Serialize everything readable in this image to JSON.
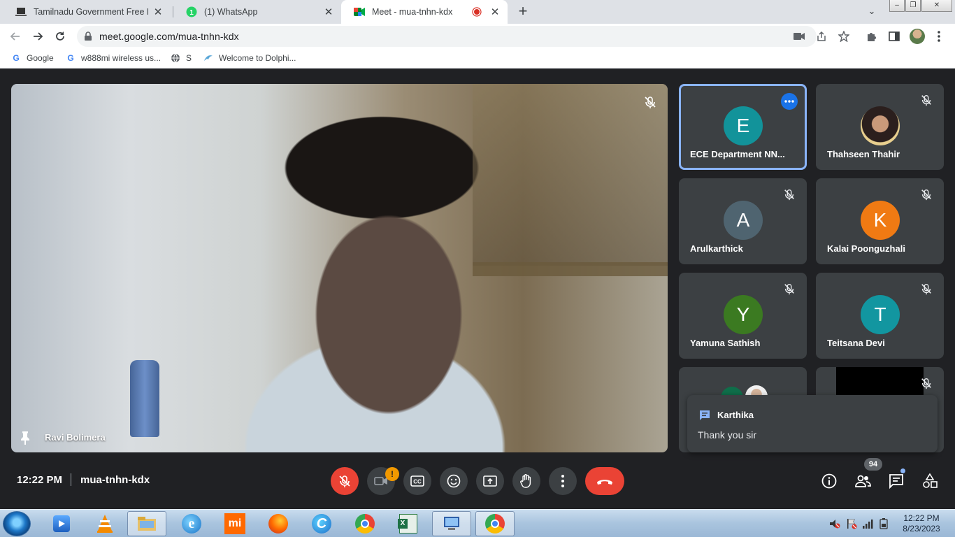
{
  "browser": {
    "tabs": [
      {
        "title": "Tamilnadu Government Free Lapt",
        "icon": "laptop-favicon"
      },
      {
        "title": "(1) WhatsApp",
        "icon": "whatsapp-favicon"
      },
      {
        "title": "Meet - mua-tnhn-kdx",
        "icon": "meet-favicon",
        "active": true,
        "recording": true
      }
    ],
    "url": "meet.google.com/mua-tnhn-kdx",
    "bookmarks": [
      {
        "label": "Google",
        "icon": "google-icon"
      },
      {
        "label": "w888mi wireless us...",
        "icon": "google-icon"
      },
      {
        "label": "S",
        "icon": "globe-icon"
      },
      {
        "label": "Welcome to Dolphi...",
        "icon": "dolphin-icon"
      }
    ]
  },
  "meeting": {
    "main_speaker": "Ravi Bolimera",
    "participants": [
      {
        "initial": "E",
        "name": "ECE Department NN...",
        "color": "#12939a",
        "highlighted": true
      },
      {
        "initial": "",
        "name": "Thahseen Thahir",
        "photo": true
      },
      {
        "initial": "A",
        "name": "Arulkarthick",
        "color": "#4f6470"
      },
      {
        "initial": "K",
        "name": "Kalai Poonguzhali",
        "color": "#f07a13"
      },
      {
        "initial": "Y",
        "name": "Yamuna Sathish",
        "color": "#3b7a21"
      },
      {
        "initial": "T",
        "name": "Teitsana Devi",
        "color": "#1296a0"
      }
    ],
    "chat_toast": {
      "sender": "Karthika",
      "message": "Thank you sir"
    },
    "time": "12:22 PM",
    "code": "mua-tnhn-kdx",
    "camera_alert": "!",
    "people_count": "94"
  },
  "taskbar": {
    "apps": [
      "media-player-icon",
      "vlc-icon",
      "file-explorer-icon",
      "internet-explorer-icon",
      "mi-icon",
      "firefox-icon",
      "ccleaner-icon",
      "chrome-icon",
      "excel-icon",
      "remote-desktop-icon",
      "chrome-active-icon"
    ],
    "clock_time": "12:22 PM",
    "clock_date": "8/23/2023"
  }
}
